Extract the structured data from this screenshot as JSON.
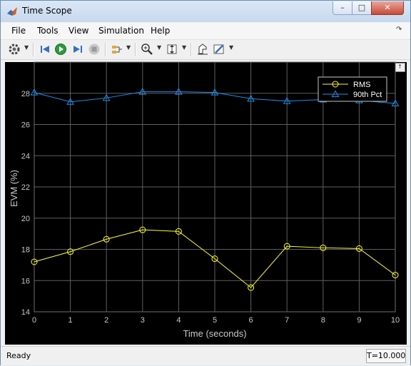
{
  "window": {
    "title": "Time Scope",
    "min_glyph": "–",
    "max_glyph": "□",
    "close_glyph": "✕"
  },
  "menu": {
    "items": [
      "File",
      "Tools",
      "View",
      "Simulation",
      "Help"
    ],
    "overflow_glyph": "↷"
  },
  "toolbar": {
    "icons": [
      "settings-icon",
      "step-back-icon",
      "run-icon",
      "step-forward-icon",
      "stop-icon",
      "signal-selector-icon",
      "zoom-in-icon",
      "autoscale-icon",
      "highlight-icon",
      "style-icon"
    ]
  },
  "status": {
    "text": "Ready",
    "time": "T=10.000"
  },
  "colors": {
    "rms": "#ffff33",
    "p90": "#1b8ff0",
    "grid": "#5f5f5f",
    "plot_bg": "#000000",
    "axis_text": "#c8c8c8"
  },
  "chart_data": {
    "type": "line",
    "xlabel": "Time (seconds)",
    "ylabel": "EVM (%)",
    "xlim": [
      0,
      10
    ],
    "ylim": [
      14,
      30
    ],
    "xticks": [
      0,
      1,
      2,
      3,
      4,
      5,
      6,
      7,
      8,
      9,
      10
    ],
    "yticks": [
      14,
      16,
      18,
      20,
      22,
      24,
      26,
      28
    ],
    "grid": true,
    "legend_position": "top-right",
    "x": [
      0,
      1,
      2,
      3,
      4,
      5,
      6,
      7,
      8,
      9,
      10
    ],
    "series": [
      {
        "name": "RMS",
        "marker": "circle",
        "values": [
          17.2,
          17.85,
          18.65,
          19.25,
          19.15,
          17.4,
          15.55,
          18.2,
          18.1,
          18.05,
          16.35
        ]
      },
      {
        "name": "90th Pct",
        "marker": "triangle",
        "values": [
          28.05,
          27.45,
          27.7,
          28.1,
          28.1,
          28.05,
          27.65,
          27.5,
          27.6,
          27.55,
          27.35
        ]
      }
    ]
  }
}
